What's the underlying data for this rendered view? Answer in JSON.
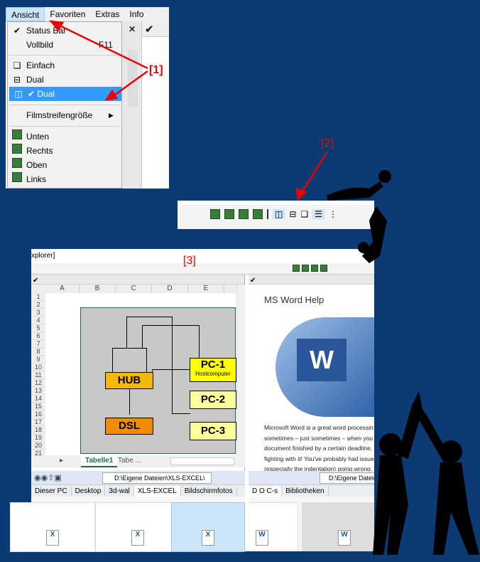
{
  "menu": {
    "items": [
      "Ansicht",
      "Favoriten",
      "Extras",
      "Info"
    ],
    "dropdown": {
      "status_bar": "Status Bar",
      "vollbild": "Vollbild",
      "vollbild_shortcut": "F11",
      "einfach": "Einfach",
      "dual1": "Dual",
      "dual2": "Dual",
      "filmstreifen": "Filmstreifengröße",
      "unten": "Unten",
      "rechts": "Rechts",
      "oben": "Oben",
      "links": "Links"
    }
  },
  "labels": {
    "l1": "[1]",
    "l2": "[2]",
    "l3": "[3]"
  },
  "window": {
    "title": "xplorer]"
  },
  "excel": {
    "columns": [
      "A",
      "B",
      "C",
      "D",
      "E"
    ],
    "rows": [
      "1",
      "2",
      "3",
      "4",
      "5",
      "6",
      "7",
      "8",
      "9",
      "10",
      "11",
      "12",
      "13",
      "14",
      "15",
      "16",
      "17",
      "18",
      "19",
      "20",
      "21"
    ],
    "diagram": {
      "hub": "HUB",
      "dsl": "DSL",
      "pc1": "PC-1",
      "pc1_sub": "Hostcomputer",
      "pc2": "PC-2",
      "pc3": "PC-3"
    },
    "sheet_tabs": [
      "Tabelle1",
      "Tabe ..."
    ]
  },
  "left_explorer": {
    "path": "D:\\Eigene Dateien\\XLS-EXCEL\\",
    "tabs": [
      "Dieser PC",
      "Desktop",
      "3d-wal",
      "XLS-EXCEL",
      "Bildschirmfotos"
    ]
  },
  "right_pane": {
    "title": "MS Word Help",
    "text": [
      "Microsoft Word is a great word processin",
      "sometimes – just sometimes – when you",
      "document finished by a certain deadline,",
      "fighting with it! You've probably had issue",
      "(especially the indentation) going wrong."
    ]
  },
  "right_explorer": {
    "path": "D:\\Eigene Dateien\\",
    "tabs": [
      "D O C-s",
      "Bibliotheken"
    ]
  },
  "colors": {
    "background": "#0b3a75",
    "annotation": "#e00000",
    "highlight": "#3399ff",
    "hub": "#f5b800",
    "dsl": "#f08c00",
    "pc": "#ffff66"
  }
}
